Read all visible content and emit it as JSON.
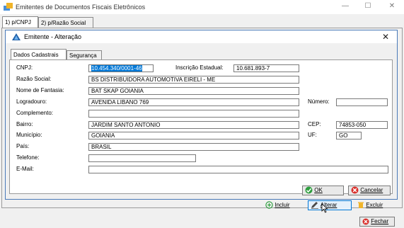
{
  "window": {
    "title": "Emitentes de Documentos Fiscais Eletrônicos",
    "controls": {
      "minimize": "—",
      "maximize": "☐",
      "close": "✕"
    }
  },
  "outer_tabs": [
    {
      "label": "1) p/CNPJ"
    },
    {
      "label": "2) p/Razão Social"
    }
  ],
  "dialog": {
    "title": "Emitente - Alteração",
    "close": "✕"
  },
  "inner_tabs": [
    {
      "label": "Dados Cadastrais"
    },
    {
      "label": "Segurança"
    }
  ],
  "form": {
    "cnpj": {
      "label": "CNPJ:",
      "value": "10.454.340/0001-46"
    },
    "inscricao_estadual": {
      "label": "Inscrição Estadual:",
      "value": "10.681.893-7"
    },
    "razao_social": {
      "label": "Razão Social:",
      "value": "BS DISTRIBUIDORA AUTOMOTIVA EIRELI - ME"
    },
    "nome_fantasia": {
      "label": "Nome de Fantasia:",
      "value": "BAT SKAP GOIANIA"
    },
    "logradouro": {
      "label": "Logradouro:",
      "value": "AVENIDA LIBANO 769"
    },
    "numero": {
      "label": "Número:",
      "value": ""
    },
    "complemento": {
      "label": "Complemento:",
      "value": ""
    },
    "bairro": {
      "label": "Bairro:",
      "value": "JARDIM SANTO ANTONIO"
    },
    "cep": {
      "label": "CEP:",
      "value": "74853-050"
    },
    "municipio": {
      "label": "Município:",
      "value": "GOIANIA"
    },
    "uf": {
      "label": "UF:",
      "value": "GO"
    },
    "pais": {
      "label": "País:",
      "value": "BRASIL"
    },
    "telefone": {
      "label": "Telefone:",
      "value": ""
    },
    "email": {
      "label": "E-Mail:",
      "value": ""
    }
  },
  "dialog_buttons": {
    "ok": {
      "label": "OK",
      "icon": "check-circle-icon"
    },
    "cancelar": {
      "label": "Cancelar",
      "icon": "cancel-circle-icon"
    }
  },
  "toolbar": {
    "incluir": {
      "label": "Incluir",
      "icon": "plus-circle-icon"
    },
    "alterar": {
      "label": "Alterar",
      "icon": "pencil-icon"
    },
    "excluir": {
      "label": "Excluir",
      "icon": "trash-icon"
    },
    "fechar": {
      "label": "Fechar",
      "icon": "close-circle-icon"
    }
  },
  "colors": {
    "selection": "#0078d7",
    "dialog_border": "#4a7ab8",
    "ok_green": "#2e9e3e",
    "cancel_red": "#d9302c"
  }
}
